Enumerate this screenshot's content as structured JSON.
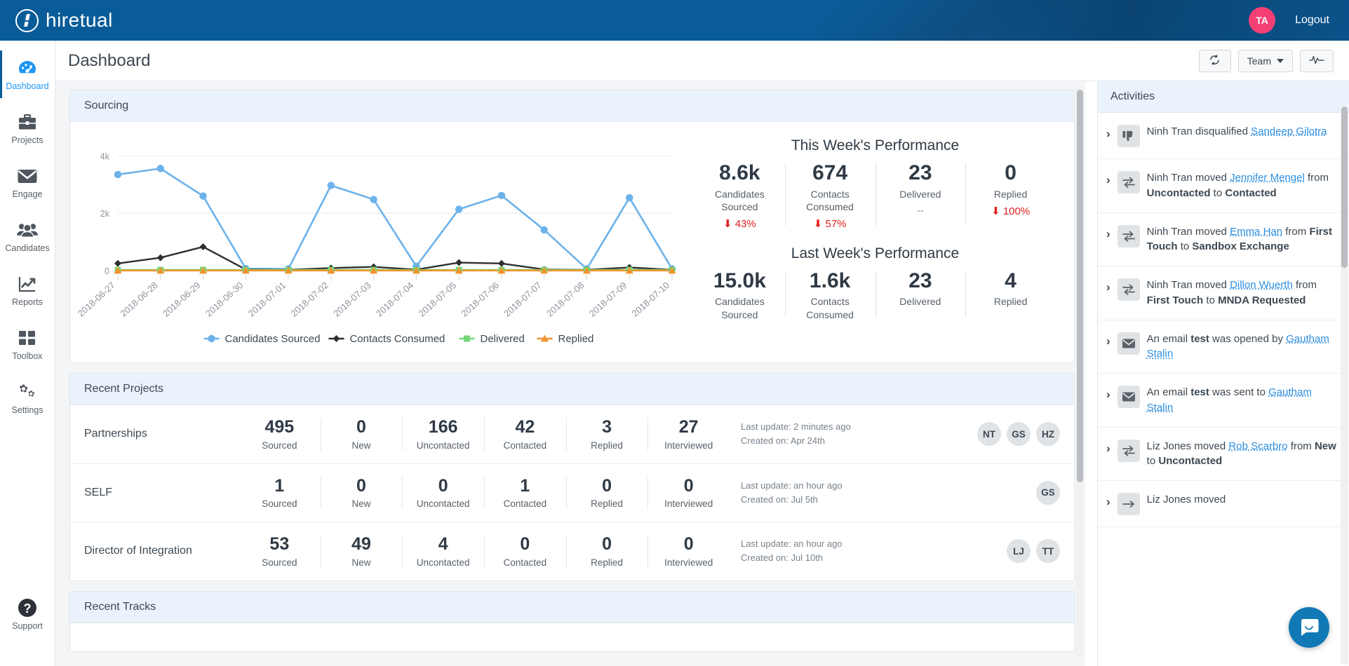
{
  "brand": {
    "name": "hiretual",
    "logo_icon": "hiretual-logo-icon"
  },
  "topbar": {
    "avatar_initials": "TA",
    "logout_label": "Logout"
  },
  "sidebar": {
    "items": [
      {
        "label": "Dashboard",
        "icon": "dashboard-gauge-icon",
        "active": true
      },
      {
        "label": "Projects",
        "icon": "briefcase-icon",
        "active": false
      },
      {
        "label": "Engage",
        "icon": "envelope-icon",
        "active": false
      },
      {
        "label": "Candidates",
        "icon": "people-group-icon",
        "active": false
      },
      {
        "label": "Reports",
        "icon": "trend-chart-icon",
        "active": false
      },
      {
        "label": "Toolbox",
        "icon": "grid-squares-icon",
        "active": false
      },
      {
        "label": "Settings",
        "icon": "gears-icon",
        "active": false
      }
    ],
    "support": {
      "label": "Support",
      "icon": "question-mark-icon"
    }
  },
  "header": {
    "title": "Dashboard",
    "refresh_button": {
      "label": "",
      "icon": "refresh-icon"
    },
    "team_button": {
      "label": "Team",
      "icon": "chevron-down-icon"
    },
    "activity_button": {
      "label": "",
      "icon": "pulse-icon"
    }
  },
  "sourcing": {
    "card_title": "Sourcing",
    "this_week": {
      "title": "This Week's Performance",
      "stats": [
        {
          "value": "8.6k",
          "label": "Candidates Sourced",
          "delta": "43%",
          "delta_dir": "down",
          "delta_color": "#e02020"
        },
        {
          "value": "674",
          "label": "Contacts Consumed",
          "delta": "57%",
          "delta_dir": "down",
          "delta_color": "#e02020"
        },
        {
          "value": "23",
          "label": "Delivered",
          "delta": "--",
          "delta_dir": "none",
          "delta_color": "#8a9099"
        },
        {
          "value": "0",
          "label": "Replied",
          "delta": "100%",
          "delta_dir": "down",
          "delta_color": "#e02020"
        }
      ]
    },
    "last_week": {
      "title": "Last Week's Performance",
      "stats": [
        {
          "value": "15.0k",
          "label": "Candidates Sourced",
          "delta": "",
          "delta_dir": "none",
          "delta_color": "#8a9099"
        },
        {
          "value": "1.6k",
          "label": "Contacts Consumed",
          "delta": "",
          "delta_dir": "none",
          "delta_color": "#8a9099"
        },
        {
          "value": "23",
          "label": "Delivered",
          "delta": "",
          "delta_dir": "none",
          "delta_color": "#8a9099"
        },
        {
          "value": "4",
          "label": "Replied",
          "delta": "",
          "delta_dir": "none",
          "delta_color": "#8a9099"
        }
      ]
    }
  },
  "chart_data": {
    "type": "line",
    "title": "Sourcing",
    "xlabel": "",
    "ylabel": "",
    "ylim": [
      0,
      4400
    ],
    "yticks": [
      0,
      2000,
      4000
    ],
    "ytick_labels": [
      "0",
      "2k",
      "4k"
    ],
    "grid": true,
    "legend_position": "bottom",
    "x": [
      "2018-06-27",
      "2018-06-28",
      "2018-06-29",
      "2018-06-30",
      "2018-07-01",
      "2018-07-02",
      "2018-07-03",
      "2018-07-04",
      "2018-07-05",
      "2018-07-06",
      "2018-07-07",
      "2018-07-08",
      "2018-07-09",
      "2018-07-10"
    ],
    "series": [
      {
        "name": "Candidates Sourced",
        "color": "#6cb2eb",
        "marker": "circle",
        "values": [
          3350,
          3560,
          2600,
          70,
          60,
          2970,
          2480,
          150,
          2140,
          2620,
          1420,
          60,
          2540,
          60
        ]
      },
      {
        "name": "Contacts Consumed",
        "color": "#2c2f33",
        "marker": "diamond",
        "values": [
          250,
          450,
          830,
          40,
          30,
          90,
          130,
          35,
          280,
          250,
          40,
          30,
          110,
          30
        ]
      },
      {
        "name": "Delivered",
        "color": "#74d87a",
        "marker": "square",
        "values": [
          23,
          23,
          23,
          23,
          23,
          23,
          23,
          23,
          23,
          23,
          23,
          23,
          23,
          23
        ]
      },
      {
        "name": "Replied",
        "color": "#f0952f",
        "marker": "triangle",
        "values": [
          4,
          4,
          4,
          4,
          4,
          4,
          4,
          4,
          4,
          4,
          4,
          4,
          4,
          4
        ]
      }
    ]
  },
  "recent_projects": {
    "card_title": "Recent Projects",
    "columns": [
      "Sourced",
      "New",
      "Uncontacted",
      "Contacted",
      "Replied",
      "Interviewed"
    ],
    "rows": [
      {
        "name": "Partnerships",
        "values": [
          "495",
          "0",
          "166",
          "42",
          "3",
          "27"
        ],
        "last_update": "Last update: 2 minutes ago",
        "created_on": "Created on: Apr 24th",
        "avatars": [
          "NT",
          "GS",
          "HZ"
        ]
      },
      {
        "name": "SELF",
        "values": [
          "1",
          "0",
          "0",
          "1",
          "0",
          "0"
        ],
        "last_update": "Last update: an hour ago",
        "created_on": "Created on: Jul 5th",
        "avatars": [
          "GS"
        ]
      },
      {
        "name": "Director of Integration",
        "values": [
          "53",
          "49",
          "4",
          "0",
          "0",
          "0"
        ],
        "last_update": "Last update: an hour ago",
        "created_on": "Created on: Jul 10th",
        "avatars": [
          "LJ",
          "TT"
        ]
      }
    ]
  },
  "recent_tracks": {
    "card_title": "Recent Tracks"
  },
  "activities": {
    "panel_title": "Activities",
    "items": [
      {
        "icon": "thumbs-down-icon",
        "parts": [
          {
            "t": "Ninh Tran disqualified ",
            "s": "plain"
          },
          {
            "t": "Sandeep Gilotra",
            "s": "link"
          }
        ]
      },
      {
        "icon": "transfer-arrows-icon",
        "parts": [
          {
            "t": "Ninh Tran moved ",
            "s": "plain"
          },
          {
            "t": "Jennifer Mengel",
            "s": "link"
          },
          {
            "t": " from ",
            "s": "plain"
          },
          {
            "t": "Uncontacted",
            "s": "bold"
          },
          {
            "t": " to ",
            "s": "plain"
          },
          {
            "t": "Contacted",
            "s": "bold"
          }
        ]
      },
      {
        "icon": "transfer-arrows-icon",
        "parts": [
          {
            "t": "Ninh Tran moved ",
            "s": "plain"
          },
          {
            "t": "Emma Han",
            "s": "link"
          },
          {
            "t": " from ",
            "s": "plain"
          },
          {
            "t": "First Touch",
            "s": "bold"
          },
          {
            "t": " to ",
            "s": "plain"
          },
          {
            "t": "Sandbox Exchange",
            "s": "bold"
          }
        ]
      },
      {
        "icon": "transfer-arrows-icon",
        "parts": [
          {
            "t": "Ninh Tran moved ",
            "s": "plain"
          },
          {
            "t": "Dillon Wuerth",
            "s": "link"
          },
          {
            "t": " from ",
            "s": "plain"
          },
          {
            "t": "First Touch",
            "s": "bold"
          },
          {
            "t": " to ",
            "s": "plain"
          },
          {
            "t": "MNDA Requested",
            "s": "bold"
          }
        ]
      },
      {
        "icon": "envelope-icon",
        "parts": [
          {
            "t": "An email ",
            "s": "plain"
          },
          {
            "t": "test",
            "s": "bold"
          },
          {
            "t": " was opened by ",
            "s": "plain"
          },
          {
            "t": "Gautham Stalin",
            "s": "link"
          }
        ]
      },
      {
        "icon": "envelope-icon",
        "parts": [
          {
            "t": "An email ",
            "s": "plain"
          },
          {
            "t": "test",
            "s": "bold"
          },
          {
            "t": " was sent to ",
            "s": "plain"
          },
          {
            "t": "Gautham Stalin",
            "s": "link"
          }
        ]
      },
      {
        "icon": "transfer-arrows-icon",
        "parts": [
          {
            "t": "Liz Jones moved ",
            "s": "plain"
          },
          {
            "t": "Rob Scarbro",
            "s": "link"
          },
          {
            "t": " from ",
            "s": "plain"
          },
          {
            "t": "New",
            "s": "bold"
          },
          {
            "t": " to ",
            "s": "plain"
          },
          {
            "t": "Uncontacted",
            "s": "bold"
          }
        ]
      },
      {
        "icon": "arrow-right-icon",
        "parts": [
          {
            "t": "Liz Jones moved",
            "s": "plain"
          }
        ]
      }
    ]
  },
  "chat": {
    "icon": "chat-bubble-icon"
  }
}
